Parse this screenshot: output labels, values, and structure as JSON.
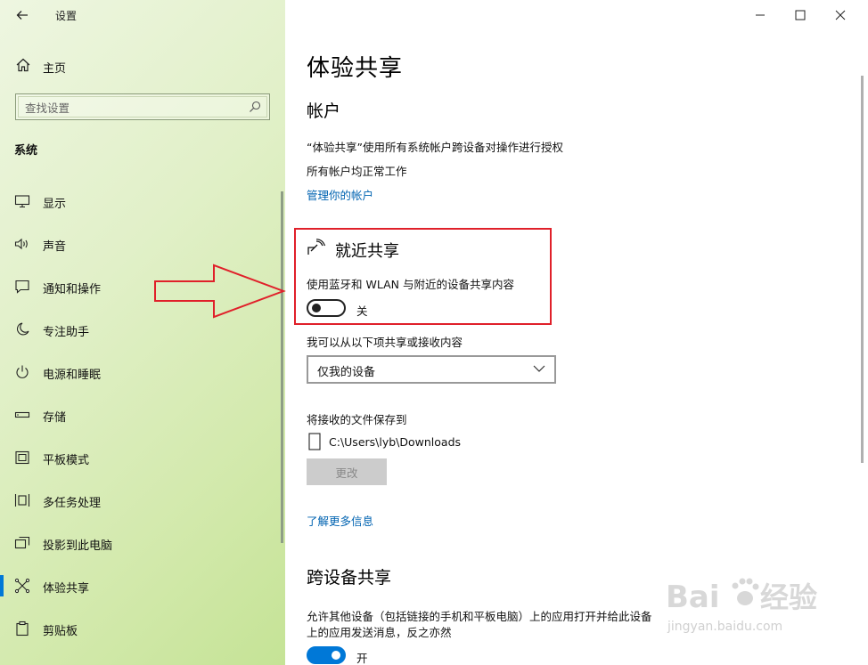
{
  "window": {
    "app_title": "设置",
    "controls": {
      "minimize": "—",
      "maximize": "☐",
      "close": "✕"
    }
  },
  "sidebar": {
    "home_label": "主页",
    "search_placeholder": "查找设置",
    "section_title": "系统",
    "items": [
      {
        "label": "显示",
        "icon": "monitor-icon"
      },
      {
        "label": "声音",
        "icon": "speaker-icon"
      },
      {
        "label": "通知和操作",
        "icon": "notification-icon"
      },
      {
        "label": "专注助手",
        "icon": "moon-icon"
      },
      {
        "label": "电源和睡眠",
        "icon": "power-icon"
      },
      {
        "label": "存储",
        "icon": "storage-icon"
      },
      {
        "label": "平板模式",
        "icon": "tablet-icon"
      },
      {
        "label": "多任务处理",
        "icon": "multitask-icon"
      },
      {
        "label": "投影到此电脑",
        "icon": "projection-icon"
      },
      {
        "label": "体验共享",
        "icon": "share-icon",
        "active": true
      },
      {
        "label": "剪贴板",
        "icon": "clipboard-icon"
      }
    ]
  },
  "main": {
    "page_title": "体验共享",
    "accounts": {
      "heading": "帐户",
      "line1": "“体验共享”使用所有系统帐户跨设备对操作进行授权",
      "line2": "所有帐户均正常工作",
      "manage_link": "管理你的帐户"
    },
    "nearby": {
      "heading": "就近共享",
      "description": "使用蓝牙和 WLAN 与附近的设备共享内容",
      "toggle_state": "关",
      "toggle_on": false,
      "receive_label": "我可以从以下项共享或接收内容",
      "receive_value": "仅我的设备",
      "save_label": "将接收的文件保存到",
      "save_path": "C:\\Users\\lyb\\Downloads",
      "change_button": "更改",
      "learn_more": "了解更多信息"
    },
    "cross_device": {
      "heading": "跨设备共享",
      "description_line1": "允许其他设备（包括链接的手机和平板电脑）上的应用打开并给此设备",
      "description_line2": "上的应用发送消息，反之亦然",
      "toggle_state": "开",
      "toggle_on": true
    }
  },
  "watermark": {
    "brand": "Bai",
    "brand2": "经验",
    "url": "jingyan.baidu.com"
  },
  "colors": {
    "accent": "#0078d7",
    "link": "#0063b1",
    "highlight": "#e0202a"
  }
}
